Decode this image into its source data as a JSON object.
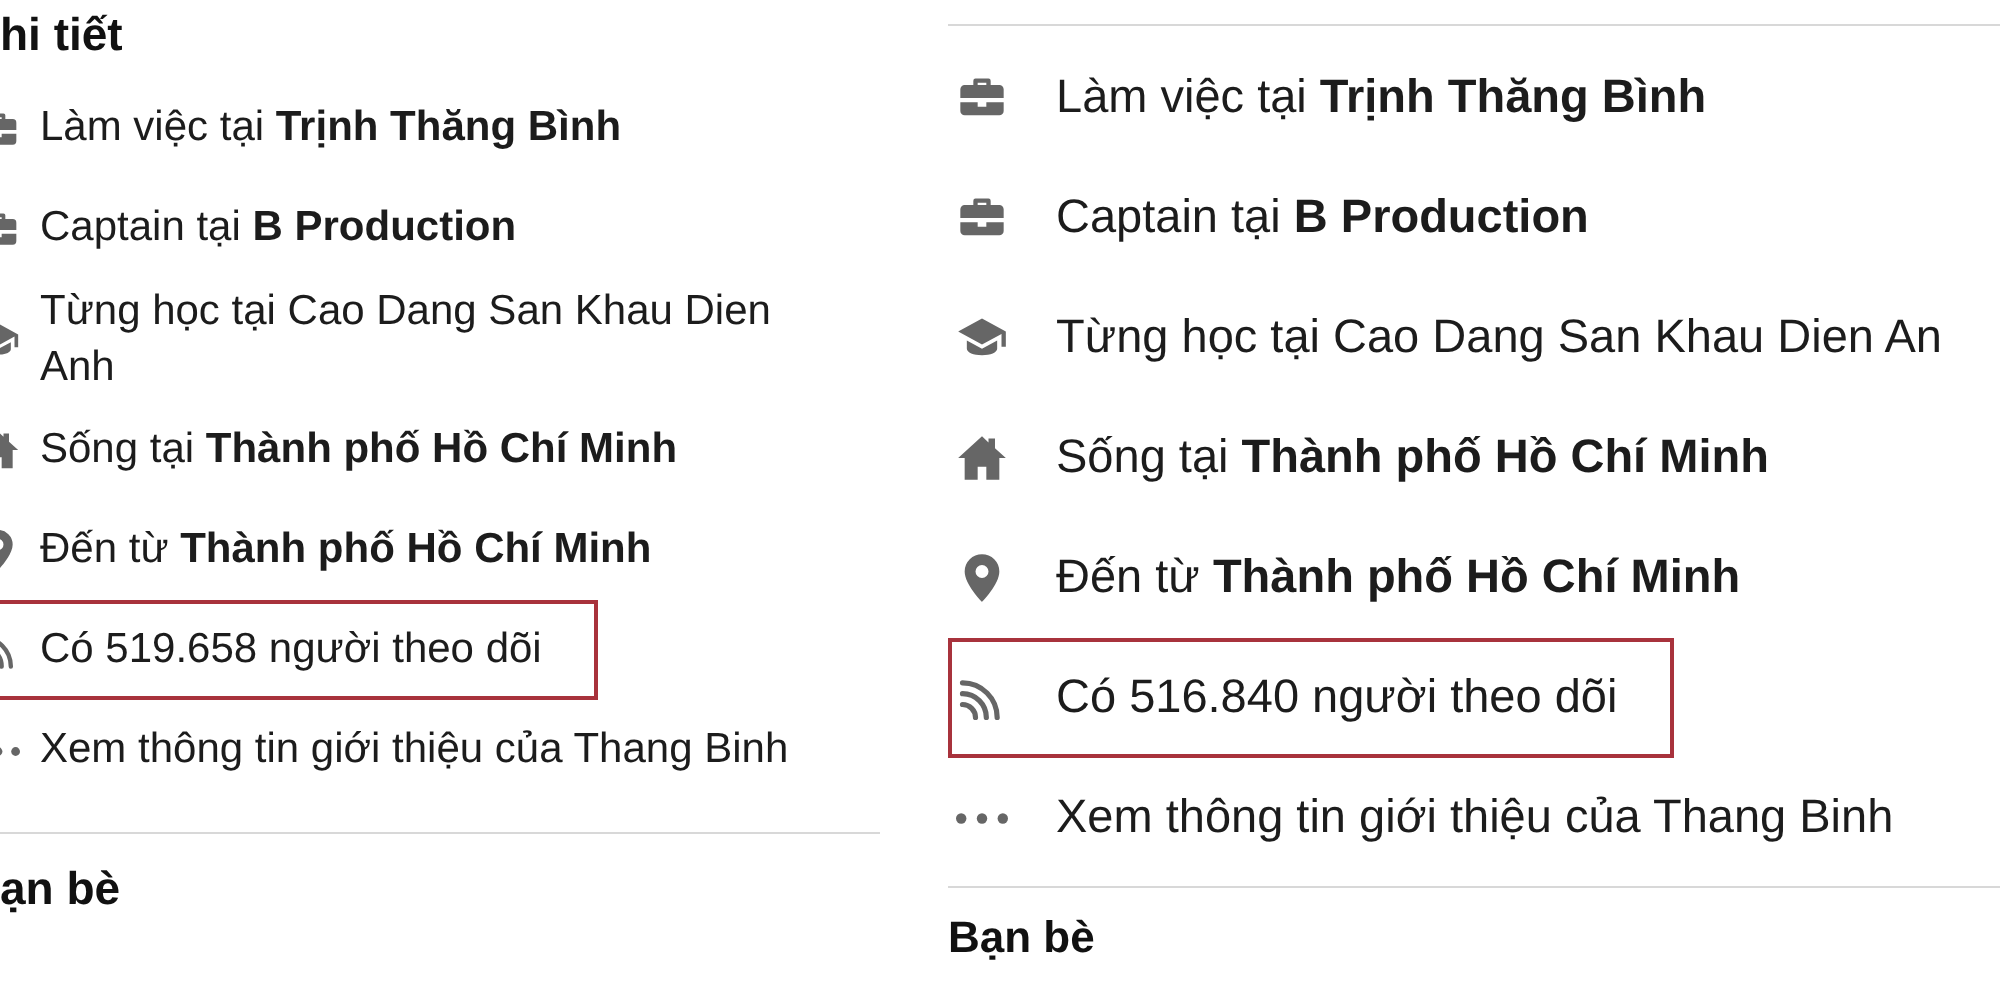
{
  "panels": [
    {
      "heading": "hi tiết",
      "rows": [
        {
          "kind": "work",
          "text": "Làm việc tại **Trịnh Thăng Bình**",
          "highlighted": false
        },
        {
          "kind": "work",
          "text": "Captain tại **B Production**",
          "highlighted": false
        },
        {
          "kind": "school",
          "text": "Từng học tại Cao Dang San Khau Dien Anh",
          "highlighted": false
        },
        {
          "kind": "home",
          "text": "Sống tại **Thành phố Hồ Chí Minh**",
          "highlighted": false
        },
        {
          "kind": "location",
          "text": "Đến từ **Thành phố Hồ Chí Minh**",
          "highlighted": false
        },
        {
          "kind": "followers",
          "text": "Có 519.658 người theo dõi",
          "highlighted": true
        },
        {
          "kind": "more",
          "text": "Xem thông tin giới thiệu của Thang Binh",
          "highlighted": false
        }
      ],
      "footer_heading": "ạn bè"
    },
    {
      "rows": [
        {
          "kind": "work",
          "text": "Làm việc tại **Trịnh Thăng Bình**",
          "highlighted": false
        },
        {
          "kind": "work",
          "text": "Captain tại **B Production**",
          "highlighted": false
        },
        {
          "kind": "school",
          "text": "Từng học tại Cao Dang San Khau Dien An",
          "highlighted": false
        },
        {
          "kind": "home",
          "text": "Sống tại **Thành phố Hồ Chí Minh**",
          "highlighted": false
        },
        {
          "kind": "location",
          "text": "Đến từ **Thành phố Hồ Chí Minh**",
          "highlighted": false
        },
        {
          "kind": "followers",
          "text": "Có 516.840 người theo dõi",
          "highlighted": true
        },
        {
          "kind": "more",
          "text": "Xem thông tin giới thiệu của Thang Binh",
          "highlighted": false
        }
      ],
      "footer_heading": "Bạn bè"
    }
  ]
}
